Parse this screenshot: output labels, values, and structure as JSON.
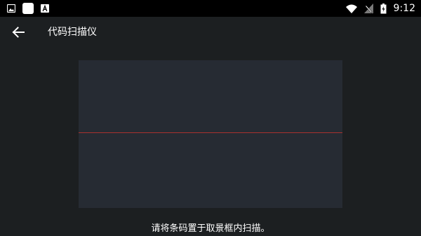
{
  "status_bar": {
    "left_icons": [
      "image-icon",
      "app-square-icon",
      "font-icon"
    ],
    "right_icons": [
      "wifi-icon",
      "no-signal-icon",
      "battery-charging-icon"
    ],
    "time": "9:12"
  },
  "app_bar": {
    "back_icon": "arrow-left-icon",
    "title": "代码扫描仪"
  },
  "scanner": {
    "laser_color": "#a8322f",
    "hint": "请将条码置于取景框内扫描。"
  },
  "colors": {
    "background": "#1c1f21",
    "viewfinder": "#262b33",
    "status_bar": "#000000"
  }
}
